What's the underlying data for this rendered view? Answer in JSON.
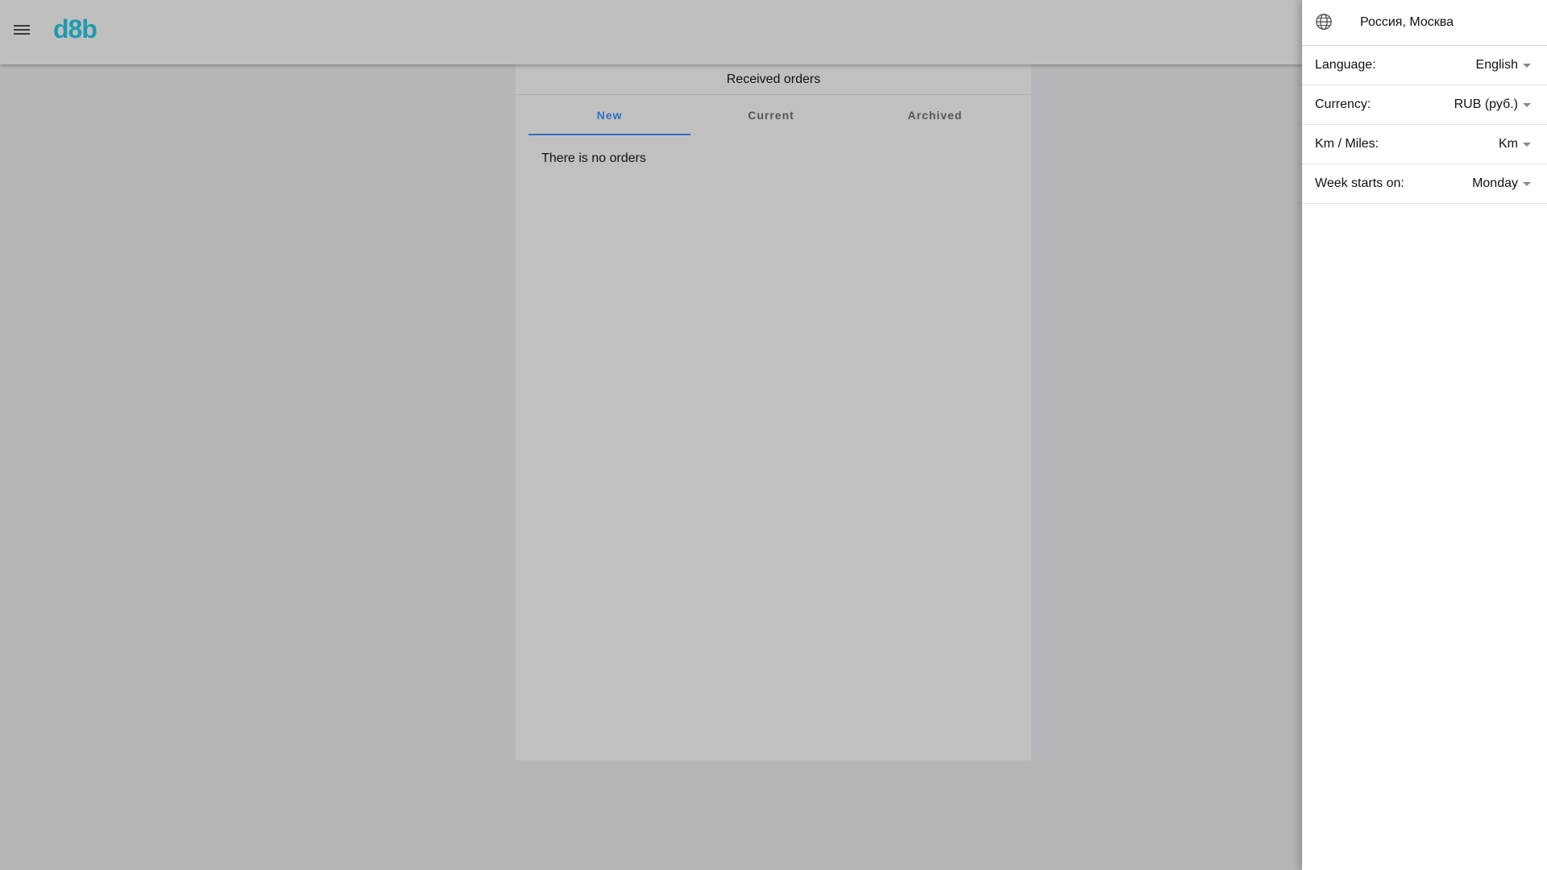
{
  "app": {
    "logo": "d8b"
  },
  "orders": {
    "title": "Received orders",
    "tabs": [
      {
        "label": "New",
        "active": true
      },
      {
        "label": "Current",
        "active": false
      },
      {
        "label": "Archived",
        "active": false
      }
    ],
    "empty_message": "There is no orders"
  },
  "drawer": {
    "location": "Россия, Москва",
    "settings": [
      {
        "label": "Language:",
        "value": "English"
      },
      {
        "label": "Currency:",
        "value": "RUB (руб.)"
      },
      {
        "label": "Km / Miles:",
        "value": "Km"
      },
      {
        "label": "Week starts on:",
        "value": "Monday"
      }
    ]
  },
  "colors": {
    "accent": "#2e6fc4",
    "logo": "#1e9bb0"
  },
  "icons": {
    "menu": "menu-icon",
    "location": "globe-icon",
    "dropdown": "caret-down-icon"
  }
}
